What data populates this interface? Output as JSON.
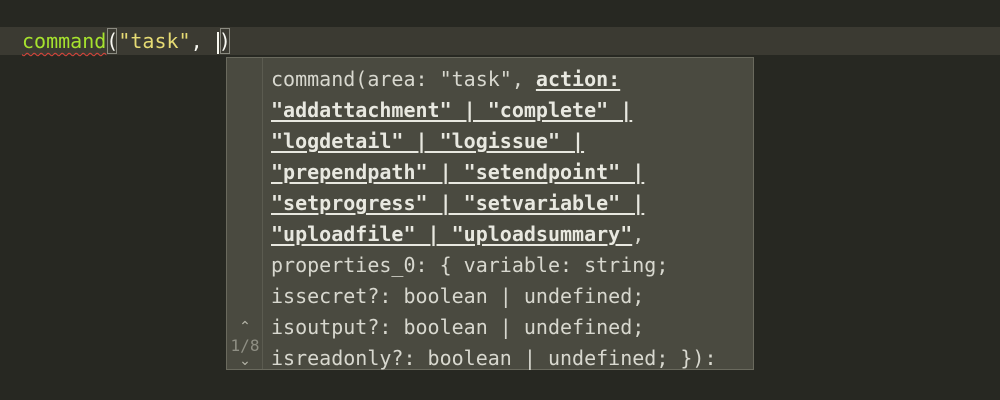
{
  "editor": {
    "code": {
      "function_name": "command",
      "open_paren": "(",
      "argument": "\"task\"",
      "separator": ", ",
      "close_paren": ")"
    }
  },
  "signature_help": {
    "counter": "1/8",
    "nav_up_icon": "chevron-up-icon",
    "nav_down_icon": "chevron-down-icon",
    "lines": [
      {
        "plain": "command(area: \"task\", ",
        "active": "action:",
        "after": ""
      },
      {
        "plain": "",
        "active": "\"addattachment\" | \"complete\" |",
        "after": ""
      },
      {
        "plain": "",
        "active": "\"logdetail\" | \"logissue\" |",
        "after": ""
      },
      {
        "plain": "",
        "active": "\"prependpath\" | \"setendpoint\" |",
        "after": ""
      },
      {
        "plain": "",
        "active": "\"setprogress\" | \"setvariable\" |",
        "after": ""
      },
      {
        "plain": "",
        "active": "\"uploadfile\" | \"uploadsummary\"",
        "after": ","
      },
      {
        "plain": "properties_0: { variable: string;",
        "active": "",
        "after": ""
      },
      {
        "plain": "issecret?: boolean | undefined;",
        "active": "",
        "after": ""
      },
      {
        "plain": "isoutput?: boolean | undefined;",
        "active": "",
        "after": ""
      },
      {
        "plain": "isreadonly?: boolean | undefined; }):",
        "active": "",
        "after": ""
      }
    ]
  },
  "colors": {
    "background": "#272822",
    "current_line": "#3b3a32",
    "function": "#a6e22e",
    "string": "#e6db74",
    "error_squiggle": "#e0443a",
    "popup_background": "#4a4a40"
  }
}
